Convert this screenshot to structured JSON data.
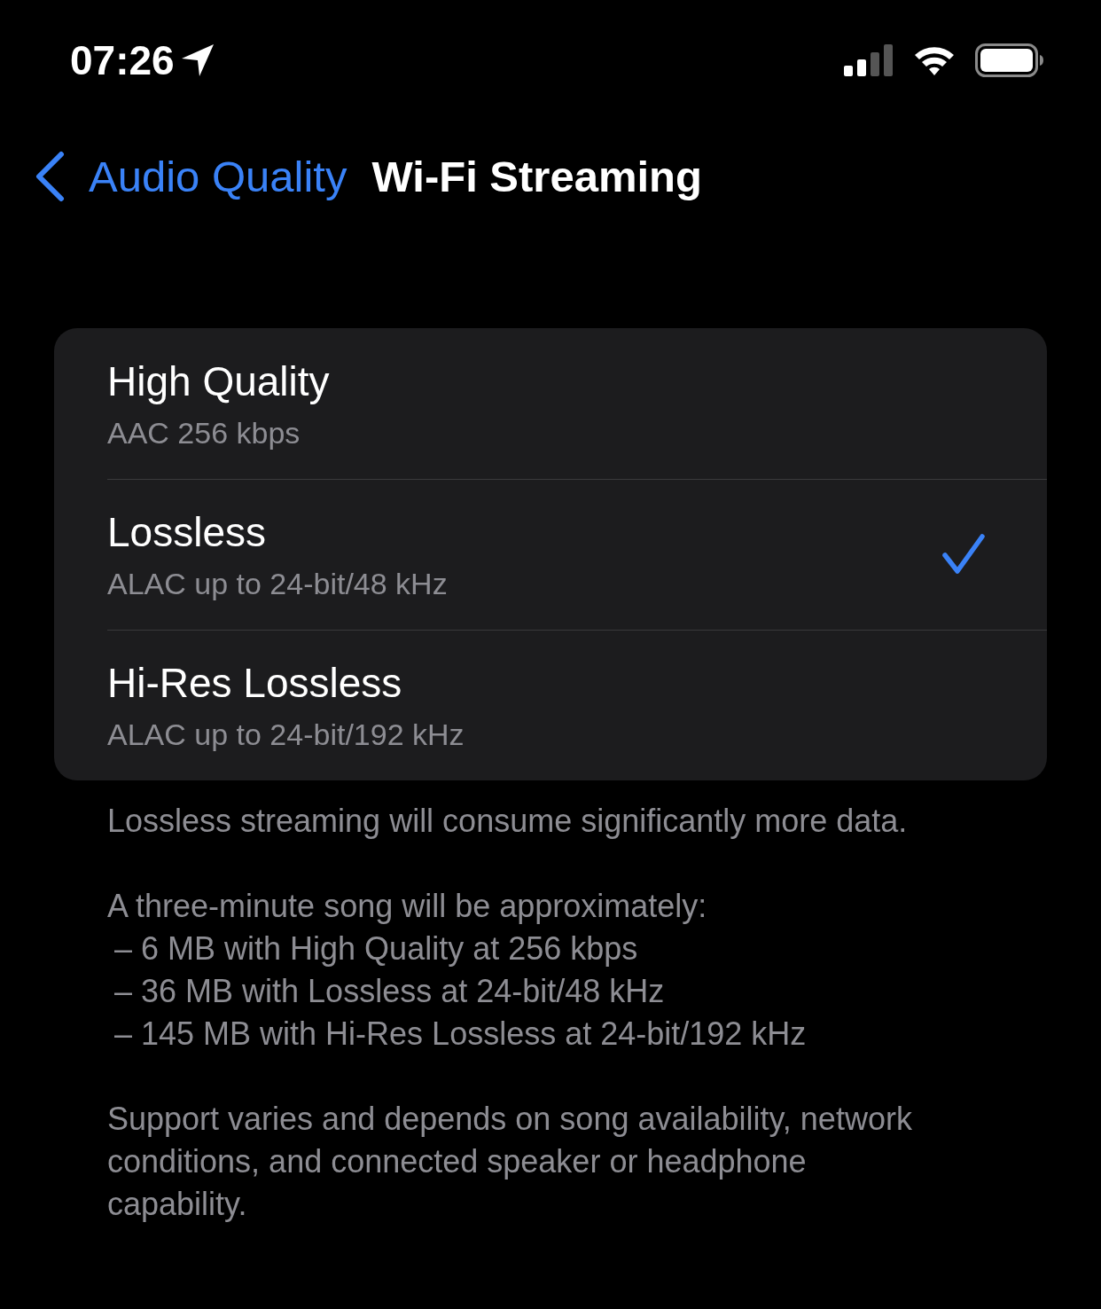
{
  "status_bar": {
    "time": "07:26"
  },
  "nav": {
    "back_label": "Audio Quality",
    "title": "Wi-Fi Streaming"
  },
  "options": [
    {
      "title": "High Quality",
      "subtitle": "AAC 256 kbps",
      "selected": false
    },
    {
      "title": "Lossless",
      "subtitle": "ALAC up to 24-bit/48 kHz",
      "selected": true
    },
    {
      "title": "Hi-Res Lossless",
      "subtitle": "ALAC up to 24-bit/192 kHz",
      "selected": false
    }
  ],
  "footer": [
    {
      "kind": "paragraph",
      "text": "Lossless streaming will consume significantly more data."
    },
    {
      "kind": "paragraph",
      "text": "A three-minute song will be approximately:"
    },
    {
      "kind": "list",
      "items": [
        "– 6 MB with High Quality at 256 kbps",
        "– 36 MB with Lossless at 24-bit/48 kHz",
        "– 145 MB with Hi-Res Lossless at 24-bit/192 kHz"
      ]
    },
    {
      "kind": "paragraph",
      "text": "Support varies and depends on song availability, network conditions, and connected speaker or headphone capability."
    }
  ]
}
